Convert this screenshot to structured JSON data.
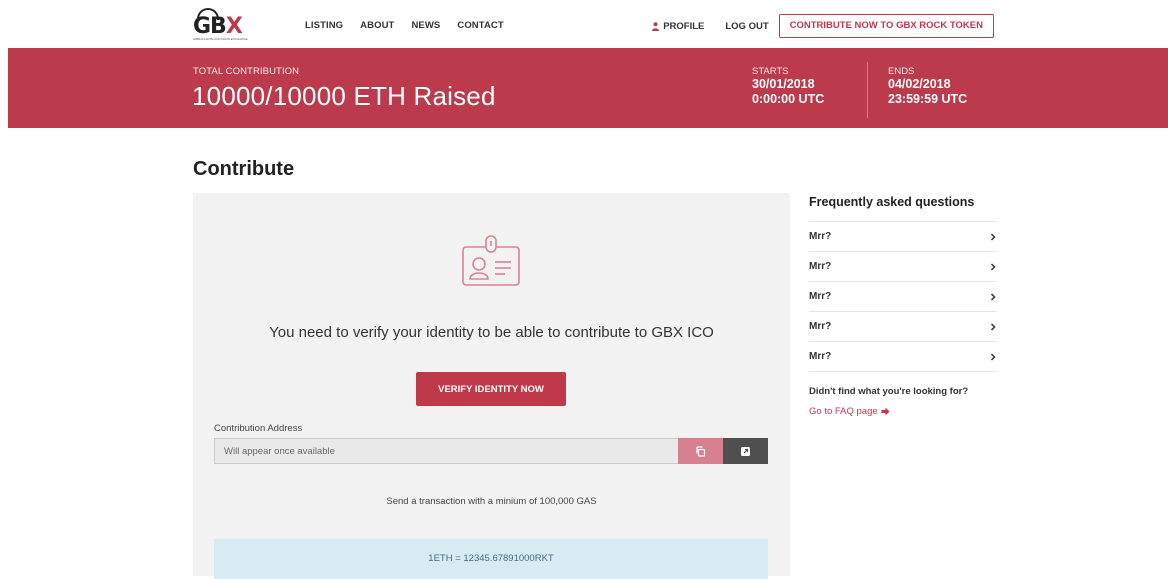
{
  "brand": {
    "logo_text_main": "GB",
    "logo_text_accent": "X",
    "logo_tagline": "GIBRALTAR BLOCKCHAIN EXCHANGE"
  },
  "nav": {
    "links": [
      "LISTING",
      "ABOUT",
      "NEWS",
      "CONTACT"
    ],
    "profile_label": "PROFILE",
    "logout_label": "LOG OUT",
    "cta_label": "CONTRIBUTE NOW TO GBX ROCK TOKEN"
  },
  "banner": {
    "total_label": "TOTAL CONTRIBUTION",
    "total_value": "10000/10000 ETH Raised",
    "starts_label": "STARTS",
    "starts_date": "30/01/2018",
    "starts_time": "0:00:00 UTC",
    "ends_label": "ENDS",
    "ends_date": "04/02/2018",
    "ends_time": "23:59:59 UTC"
  },
  "contribute": {
    "title": "Contribute",
    "verify_message": "You need to verify your identity to be able to contribute to GBX ICO",
    "verify_button": "VERIFY IDENTITY NOW",
    "address_label": "Contribution Address",
    "address_placeholder": "Will appear once available",
    "gas_note": "Send a transaction with a minium of 100,000 GAS",
    "rate": "1ETH = 12345.67891000RKT"
  },
  "faq": {
    "title": "Frequently asked questions",
    "items": [
      "Mrr?",
      "Mrr?",
      "Mrr?",
      "Mrr?",
      "Mrr?"
    ],
    "more_text": "Didn't find what you're looking for?",
    "link_text": "Go to FAQ page"
  },
  "colors": {
    "accent": "#c0394b",
    "banner": "#bb3a4c",
    "panel": "#f2f2f2",
    "rate_box": "#d7ebf2"
  }
}
